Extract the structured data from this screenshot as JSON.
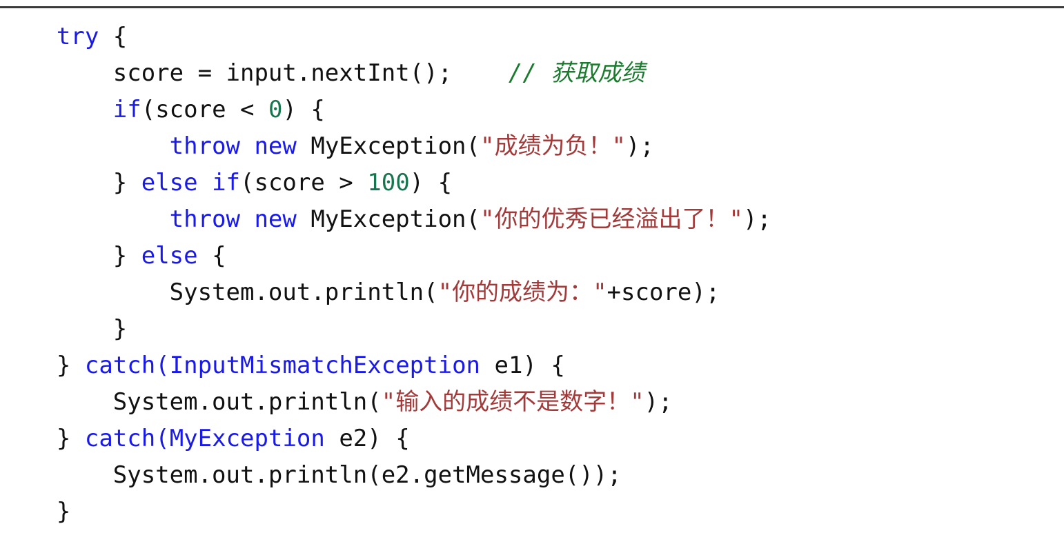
{
  "slide": {
    "background_color": "#ffffff",
    "top_rule_color": "#3a3a3a"
  },
  "theme": {
    "keyword_color": "#1a1ae6",
    "type_color": "#1a1ae6",
    "plain_color": "#111111",
    "number_color": "#17764f",
    "string_color": "#a33a3a",
    "comment_color": "#1a7a2e"
  },
  "code": {
    "language": "Java",
    "lines": [
      {
        "indent": "    ",
        "tokens": [
          {
            "kind": "keyword",
            "text": "try"
          },
          {
            "kind": "plain",
            "text": " {"
          }
        ],
        "plain_text": "    try {"
      },
      {
        "indent": "        ",
        "tokens": [
          {
            "kind": "plain",
            "text": "score = input.nextInt();    "
          },
          {
            "kind": "comment",
            "text": "// 获取成绩"
          }
        ],
        "plain_text": "        score = input.nextInt();    // 获取成绩"
      },
      {
        "indent": "        ",
        "tokens": [
          {
            "kind": "keyword",
            "text": "if"
          },
          {
            "kind": "plain",
            "text": "(score < "
          },
          {
            "kind": "number",
            "text": "0"
          },
          {
            "kind": "plain",
            "text": ") {"
          }
        ],
        "plain_text": "        if(score < 0) {"
      },
      {
        "indent": "            ",
        "tokens": [
          {
            "kind": "keyword",
            "text": "throw new"
          },
          {
            "kind": "plain",
            "text": " MyException("
          },
          {
            "kind": "string",
            "text": "\"成绩为负！\""
          },
          {
            "kind": "plain",
            "text": ");"
          }
        ],
        "plain_text": "            throw new MyException(\"成绩为负！\");"
      },
      {
        "indent": "        ",
        "tokens": [
          {
            "kind": "plain",
            "text": "} "
          },
          {
            "kind": "keyword",
            "text": "else if"
          },
          {
            "kind": "plain",
            "text": "(score > "
          },
          {
            "kind": "number",
            "text": "100"
          },
          {
            "kind": "plain",
            "text": ") {"
          }
        ],
        "plain_text": "        } else if(score > 100) {"
      },
      {
        "indent": "            ",
        "tokens": [
          {
            "kind": "keyword",
            "text": "throw new"
          },
          {
            "kind": "plain",
            "text": " MyException("
          },
          {
            "kind": "string",
            "text": "\"你的优秀已经溢出了！\""
          },
          {
            "kind": "plain",
            "text": ");"
          }
        ],
        "plain_text": "            throw new MyException(\"你的优秀已经溢出了！\");"
      },
      {
        "indent": "        ",
        "tokens": [
          {
            "kind": "plain",
            "text": "} "
          },
          {
            "kind": "keyword",
            "text": "else"
          },
          {
            "kind": "plain",
            "text": " {"
          }
        ],
        "plain_text": "        } else {"
      },
      {
        "indent": "            ",
        "tokens": [
          {
            "kind": "plain",
            "text": "System.out.println("
          },
          {
            "kind": "string",
            "text": "\"你的成绩为：\""
          },
          {
            "kind": "plain",
            "text": "+score);"
          }
        ],
        "plain_text": "            System.out.println(\"你的成绩为：\"+score);"
      },
      {
        "indent": "        ",
        "tokens": [
          {
            "kind": "plain",
            "text": "}"
          }
        ],
        "plain_text": "        }"
      },
      {
        "indent": "    ",
        "tokens": [
          {
            "kind": "plain",
            "text": "} "
          },
          {
            "kind": "keyword",
            "text": "catch"
          },
          {
            "kind": "keyword",
            "text": "("
          },
          {
            "kind": "type",
            "text": "InputMismatchException"
          },
          {
            "kind": "plain",
            "text": " e1) {"
          }
        ],
        "plain_text": "    } catch(InputMismatchException e1) {"
      },
      {
        "indent": "        ",
        "tokens": [
          {
            "kind": "plain",
            "text": "System.out.println("
          },
          {
            "kind": "string",
            "text": "\"输入的成绩不是数字！\""
          },
          {
            "kind": "plain",
            "text": ");"
          }
        ],
        "plain_text": "        System.out.println(\"输入的成绩不是数字！\");"
      },
      {
        "indent": "    ",
        "tokens": [
          {
            "kind": "plain",
            "text": "} "
          },
          {
            "kind": "keyword",
            "text": "catch"
          },
          {
            "kind": "keyword",
            "text": "("
          },
          {
            "kind": "type",
            "text": "MyException"
          },
          {
            "kind": "plain",
            "text": " e2) {"
          }
        ],
        "plain_text": "    } catch(MyException e2) {"
      },
      {
        "indent": "        ",
        "tokens": [
          {
            "kind": "plain",
            "text": "System.out.println(e2.getMessage());"
          }
        ],
        "plain_text": "        System.out.println(e2.getMessage());"
      },
      {
        "indent": "    ",
        "tokens": [
          {
            "kind": "plain",
            "text": "}"
          }
        ],
        "plain_text": "    }"
      }
    ]
  }
}
